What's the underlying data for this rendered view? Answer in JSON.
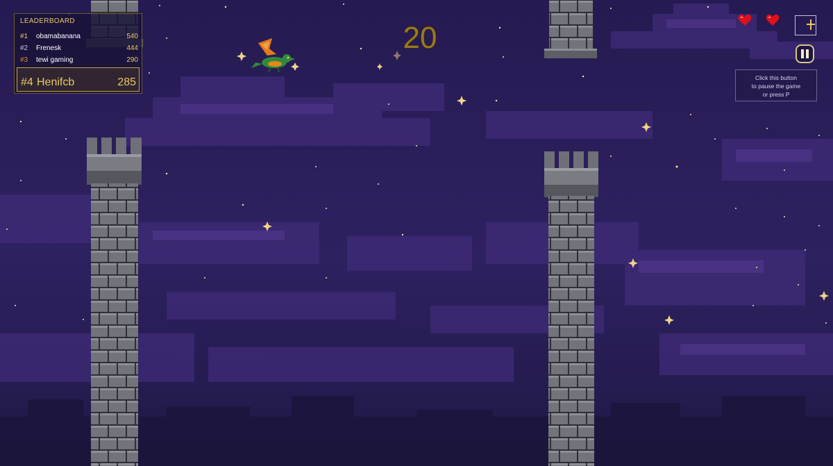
{
  "leaderboard": {
    "title": "LEADERBOARD",
    "entries": [
      {
        "rank": "#1",
        "name": "obamabanana",
        "score": "540"
      },
      {
        "rank": "#2",
        "name": "Frenesk",
        "score": "444"
      },
      {
        "rank": "#3",
        "name": "tewi gaming",
        "score": "290"
      }
    ],
    "current_player": {
      "rank": "#4",
      "name": "Henifcb",
      "score": "285"
    }
  },
  "hud": {
    "score": "20",
    "lives": 2,
    "pause_tooltip": [
      "Click this button",
      "to pause the game",
      "or press P"
    ]
  },
  "colors": {
    "sky": "#2c1f5a",
    "gold": "#e9c866",
    "rank_1": "#e9c866",
    "rank_2": "#c8c8d8",
    "rank_3": "#d98a3a",
    "heart": "#e0101a"
  },
  "icons": {
    "lives": "heart-icon",
    "fullscreen": "plus-icon",
    "pause": "pause-icon",
    "player": "dragon-icon"
  }
}
